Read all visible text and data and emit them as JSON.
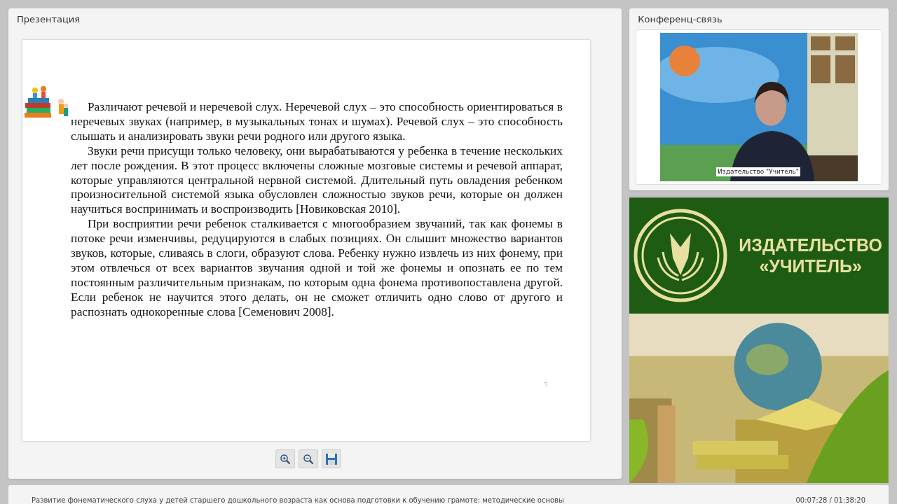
{
  "presentation": {
    "title": "Презентация",
    "slide": {
      "paragraphs": [
        "Различают речевой и неречевой слух. Неречевой слух – это способность ориентироваться в неречевых звуках (например, в музыкальных тонах и шумах). Речевой слух – это способность слышать и анализировать звуки речи родного или другого языка.",
        "Звуки речи присущи только человеку, они вырабатываются у ребенка в течение нескольких лет после рождения. В этот процесс включены сложные мозговые системы и речевой аппарат, которые управляются центральной нервной системой. Длительный путь овладения ребенком произносительной системой языка обусловлен сложностью звуков речи, которые он должен научиться воспринимать и воспроизводить [Новиковская 2010].",
        "При восприятии речи ребенок сталкивается с многообразием звучаний, так как фонемы в потоке речи изменчивы, редуцируются в слабых позициях. Он слышит множество вариантов звуков, которые, сливаясь в слоги, образуют слова. Ребенку нужно извлечь из них фонему, при этом отвлечься от всех вариантов звучания одной и той же фонемы и опознать ее по тем постоянным различительным признакам, по которым одна фонема противопоставлена другой. Если ребенок не научится этого делать, он не сможет отличить одно слово от другого и распознать однокоренные слова [Семенович 2008]."
      ],
      "page_number": "5"
    },
    "toolbar": [
      {
        "kind": "zoom-in"
      },
      {
        "kind": "zoom-out"
      },
      {
        "kind": "save"
      }
    ]
  },
  "conference": {
    "title": "Конференц-связь",
    "speaker_label": "Издательство \"Учитель\""
  },
  "banner": {
    "line1": "ИЗДАТЕЛЬСТВО",
    "line2": "«УЧИТЕЛЬ»"
  },
  "status_bar": {
    "course_title": "Развитие фонематического слуха у детей старшего дошкольного возраста как основа подготовки к обучению грамоте: методические основы",
    "time": "00:07:28 / 01:38:20"
  }
}
